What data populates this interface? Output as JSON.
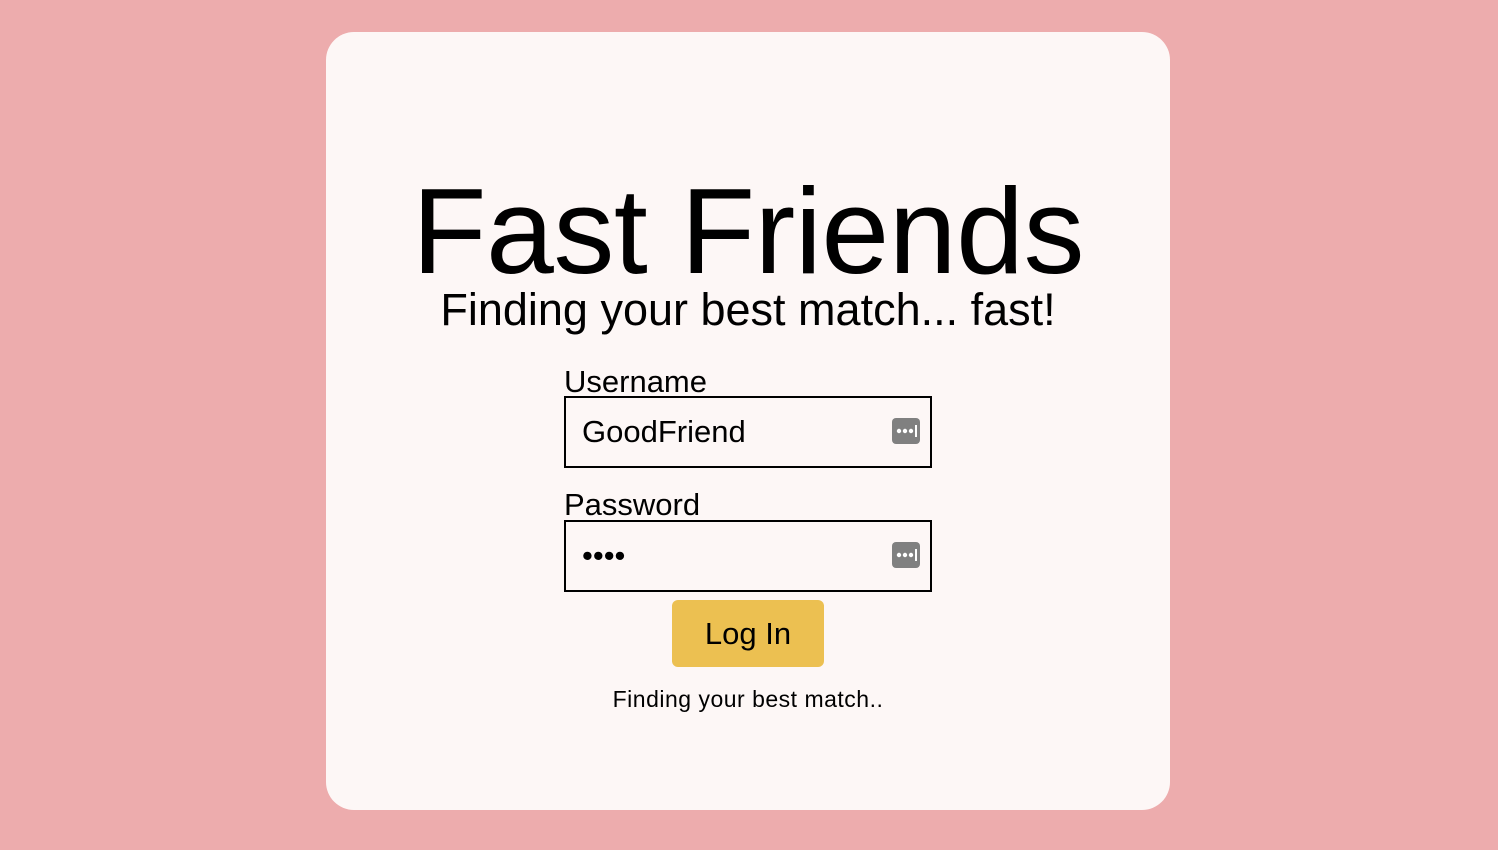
{
  "app": {
    "title": "Fast Friends",
    "tagline": "Finding your best match... fast!"
  },
  "form": {
    "username": {
      "label": "Username",
      "value": "GoodFriend"
    },
    "password": {
      "label": "Password",
      "value": "••••"
    },
    "submit_label": "Log In",
    "status": "Finding your best match.."
  },
  "icons": {
    "autofill": "password-autofill-key-icon"
  },
  "colors": {
    "background": "#edacad",
    "card": "#fdf7f6",
    "button": "#ecc051",
    "icon": "#808080"
  }
}
